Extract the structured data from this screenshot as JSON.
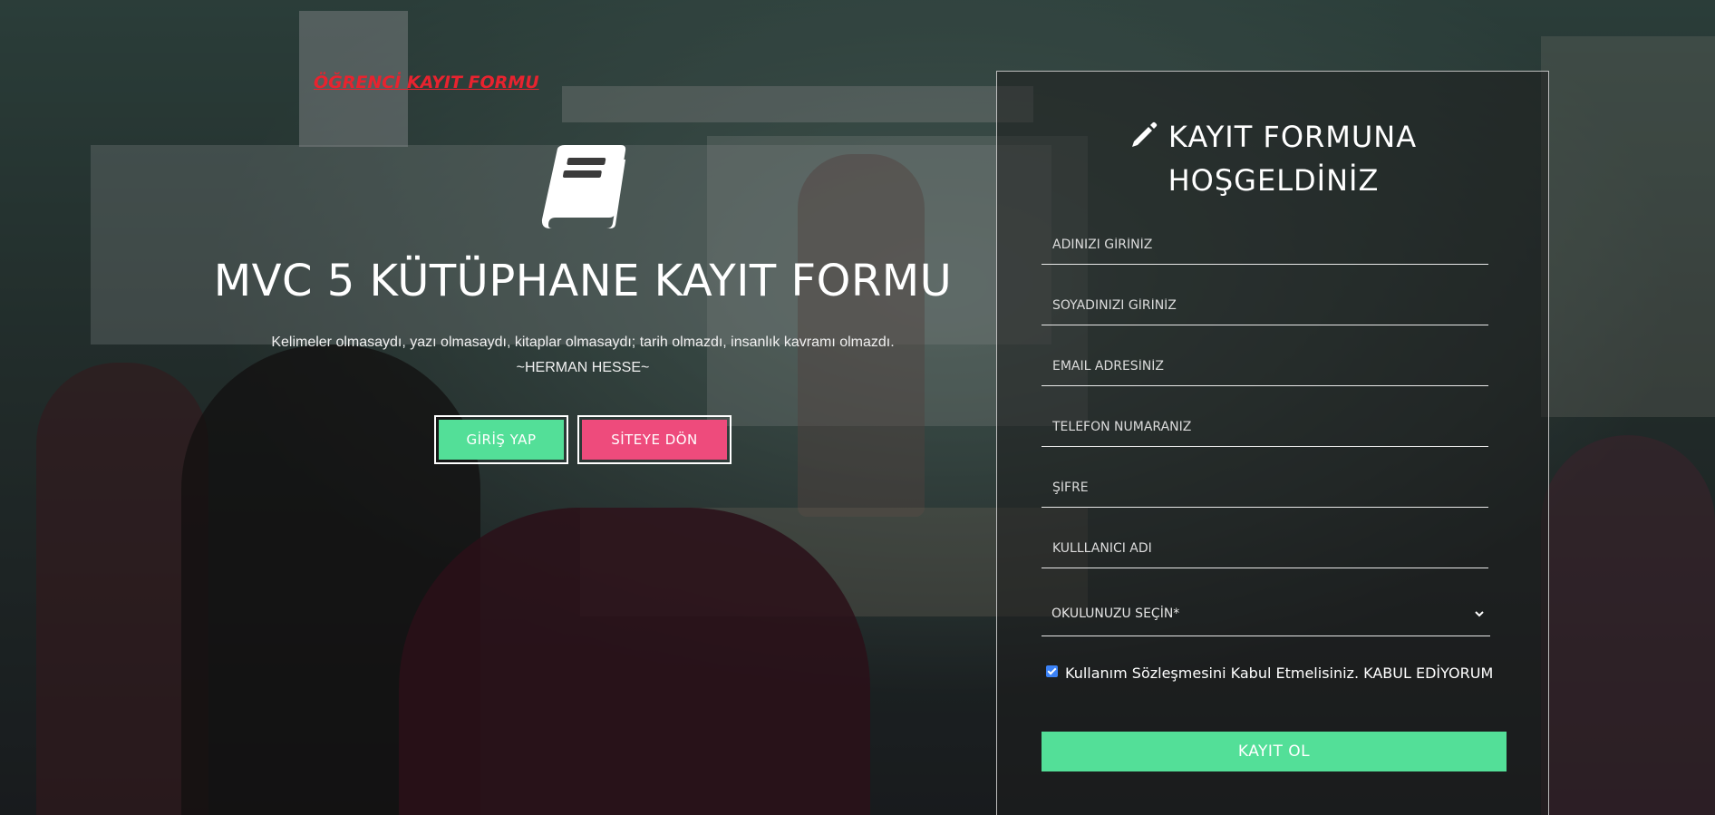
{
  "top_link": "ÖĞRENCİ KAYIT FORMU",
  "hero": {
    "icon": "book-icon",
    "title": "MVC 5 KÜTÜPHANE KAYIT FORMU",
    "quote": "Kelimeler olmasaydı, yazı olmasaydı, kitaplar olmasaydı; tarih olmazdı, insanlık kavramı olmazdı.",
    "quote_author": "~HERMAN HESSE~",
    "login_label": "GİRİŞ YAP",
    "back_label": "SİTEYE DÖN"
  },
  "form": {
    "title_line1": "KAYIT FORMUNA",
    "title_line2": "HOŞGELDİNİZ",
    "title_icon": "pencil-icon",
    "fields": {
      "first_name": "ADINIZI GİRİNİZ",
      "last_name": "SOYADINIZI GİRİNİZ",
      "email": "EMAIL ADRESİNİZ",
      "phone": "TELEFON NUMARANIZ",
      "password": "ŞİFRE",
      "username": "KULLLANICI ADI"
    },
    "school_select": "OKULUNUZU SEÇİN*",
    "consent_text": "Kullanım Sözleşmesini Kabul Etmelisiniz. KABUL EDİYORUM",
    "consent_checked": true,
    "submit_label": "KAYIT OL"
  },
  "colors": {
    "accent_green": "#53df98",
    "accent_pink": "#ee4b7c",
    "link_red": "#e8232f",
    "checkbox_blue": "#3b82f6"
  }
}
